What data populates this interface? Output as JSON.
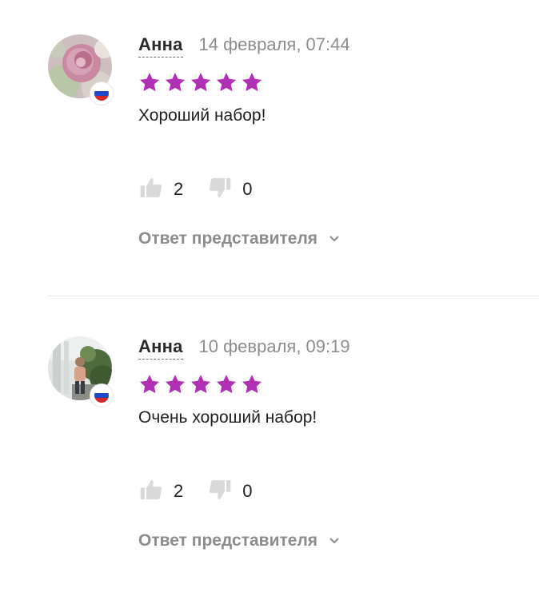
{
  "reviews": [
    {
      "author": "Анна",
      "date": "14 февраля, 07:44",
      "rating": 5,
      "text": "Хороший набор!",
      "likes": "2",
      "dislikes": "0",
      "reply_label": "Ответ представителя",
      "avatar": "rose-photo",
      "country_flag": "russia-flag-icon"
    },
    {
      "author": "Анна",
      "date": "10 февраля, 09:19",
      "rating": 5,
      "text": "Очень хороший набор!",
      "likes": "2",
      "dislikes": "0",
      "reply_label": "Ответ представителя",
      "avatar": "person-photo",
      "country_flag": "russia-flag-icon"
    }
  ],
  "colors": {
    "star": "#b12fb4",
    "secondary_text": "#8d8d8d",
    "vote_icon": "#d9d9d9",
    "divider": "#e7e7e7"
  }
}
